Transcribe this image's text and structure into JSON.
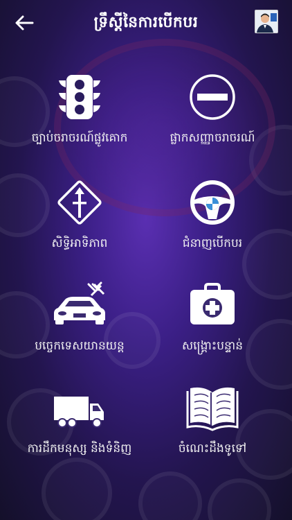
{
  "header": {
    "title": "ទ្រឹស្តីនៃការបើកបរ",
    "back_icon": "arrow-left-icon",
    "avatar": "profile-avatar"
  },
  "menu": [
    {
      "label": "ច្បាប់ចរាចរណ៍ផ្លូវគោក",
      "icon": "traffic-light-icon"
    },
    {
      "label": "ផ្លាកសញ្ញាចរាចរណ៍",
      "icon": "no-entry-sign-icon"
    },
    {
      "label": "សិទ្ធិអាទិភាព",
      "icon": "priority-road-sign-icon"
    },
    {
      "label": "ជំនាញបើកបរ",
      "icon": "steering-wheel-icon"
    },
    {
      "label": "បច្ចេកទេសយានយន្ត",
      "icon": "car-repair-icon"
    },
    {
      "label": "សង្គ្រោះបន្ទាន់",
      "icon": "first-aid-kit-icon"
    },
    {
      "label": "ការដឹកមនុស្ស និងទំនិញ",
      "icon": "truck-icon"
    },
    {
      "label": "ចំណេះដឹងទូទៅ",
      "icon": "open-book-icon"
    }
  ],
  "colors": {
    "background_center": "#5a2fb2",
    "background_edge": "#14102a",
    "icon": "#ffffff"
  }
}
